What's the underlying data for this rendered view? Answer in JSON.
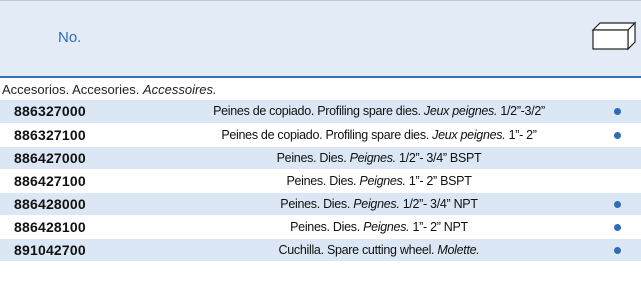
{
  "header": {
    "col_no": "No."
  },
  "section": {
    "es": "Accesorios.",
    "en": "Accesories.",
    "fr": "Accessoires."
  },
  "colors": {
    "accent": "#2f6db5",
    "row_shade": "#dbe7f4",
    "header_band": "#e3ecf6"
  },
  "icons": {
    "box": "box-outline-icon",
    "availability": "blue-dot-icon"
  },
  "rows": [
    {
      "code": "886327000",
      "es": "Peines de copiado.",
      "en": "Profiling spare dies.",
      "fr": "Jeux peignes.",
      "size": "1/2”-3/2”",
      "dot": true,
      "shaded": true
    },
    {
      "code": "886327100",
      "es": "Peines de copiado.",
      "en": "Profiling spare dies.",
      "fr": "Jeux peignes.",
      "size": "1”- 2”",
      "dot": true,
      "shaded": false
    },
    {
      "code": "886427000",
      "es": "Peines.",
      "en": "Dies.",
      "fr": "Peignes.",
      "size": "1/2”- 3/4” BSPT",
      "dot": false,
      "shaded": true
    },
    {
      "code": "886427100",
      "es": "Peines.",
      "en": "Dies.",
      "fr": "Peignes.",
      "size": "1”- 2” BSPT",
      "dot": false,
      "shaded": false
    },
    {
      "code": "886428000",
      "es": "Peines.",
      "en": "Dies.",
      "fr": "Peignes.",
      "size": "1/2”- 3/4” NPT",
      "dot": true,
      "shaded": true
    },
    {
      "code": "886428100",
      "es": "Peines.",
      "en": "Dies.",
      "fr": "Peignes.",
      "size": "1”- 2” NPT",
      "dot": true,
      "shaded": false
    },
    {
      "code": "891042700",
      "es": "Cuchilla.",
      "en": "Spare cutting wheel.",
      "fr": "Molette.",
      "size": "",
      "dot": true,
      "shaded": true
    }
  ]
}
